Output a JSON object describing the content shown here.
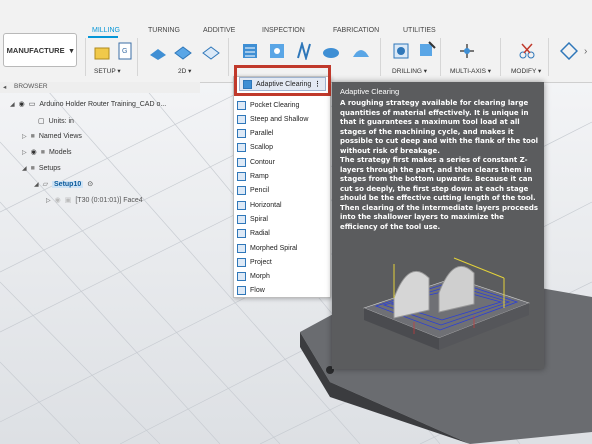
{
  "workspace": {
    "label": "MANUFACTURE"
  },
  "tabs": [
    {
      "label": "MILLING",
      "active": true
    },
    {
      "label": "TURNING"
    },
    {
      "label": "ADDITIVE"
    },
    {
      "label": "INSPECTION"
    },
    {
      "label": "FABRICATION"
    },
    {
      "label": "UTILITIES"
    }
  ],
  "groups": {
    "setup": "SETUP ▾",
    "two_d": "2D ▾",
    "drilling": "DRILLING ▾",
    "multi_axis": "MULTI-AXIS ▾",
    "modify": "MODIFY ▾"
  },
  "browser": {
    "title": "BROWSER",
    "items": {
      "doc": "Arduino Holder Router Training_CAD o...",
      "units": "Units: in",
      "named_views": "Named Views",
      "models": "Models",
      "setups": "Setups",
      "setup10": "Setup10",
      "op": "[T30 (0:01:01)] Face4"
    }
  },
  "menu": {
    "active_item": "Adaptive Clearing",
    "more": "⋮",
    "items": [
      "Pocket Clearing",
      "Steep and Shallow",
      "Parallel",
      "Scallop",
      "Contour",
      "Ramp",
      "Pencil",
      "Horizontal",
      "Spiral",
      "Radial",
      "Morphed Spiral",
      "Project",
      "Morph",
      "Flow"
    ]
  },
  "tooltip": {
    "title": "Adaptive Clearing",
    "para1": "A roughing strategy available for clearing large quantities of material effectively. It is unique in that it guarantees a maximum tool load at all stages of the machining cycle, and makes it possible to cut deep and with the flank of the tool without risk of breakage.",
    "para2": "The strategy first makes a series of constant Z-layers through the part, and then clears them in stages from the bottom upwards. Because it can cut so deeply, the first step down at each stage should be the effective cutting length of the tool. Then clearing of the intermediate layers proceeds into the shallower layers to maximize the efficiency of the tool use."
  },
  "colors": {
    "accent": "#0696d7",
    "highlight_box": "#c0392b",
    "tooltip_bg": "#5b5c5e"
  }
}
